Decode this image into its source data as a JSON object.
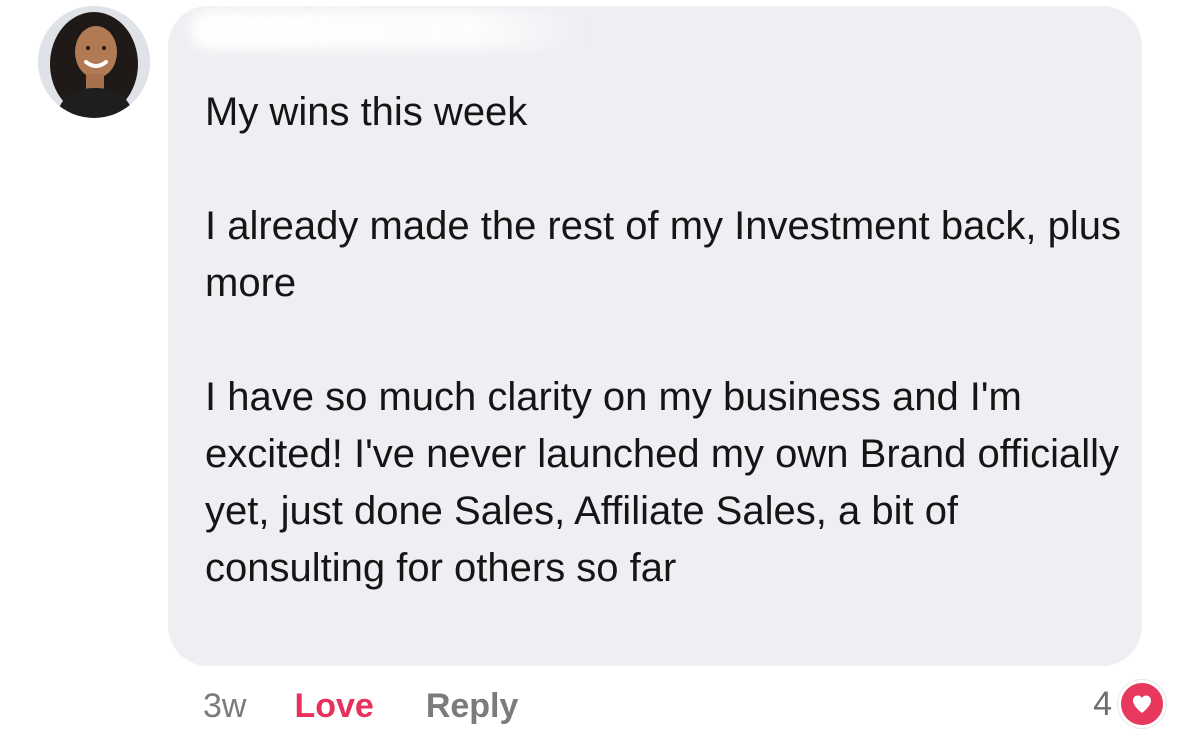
{
  "comment": {
    "author_fragment": "",
    "paragraphs": [
      "My wins this week",
      "I already made the rest of my Investment back, plus more",
      "I have so much clarity on my business and I'm excited! I've never launched my own Brand officially yet, just done Sales, Affiliate Sales, a bit of consulting for others so far"
    ]
  },
  "actions": {
    "time": "3w",
    "love_label": "Love",
    "reply_label": "Reply"
  },
  "reactions": {
    "count": "4",
    "icon": "heart-icon",
    "color": "#e8385d"
  },
  "avatar": {
    "icon": "avatar-photo"
  }
}
